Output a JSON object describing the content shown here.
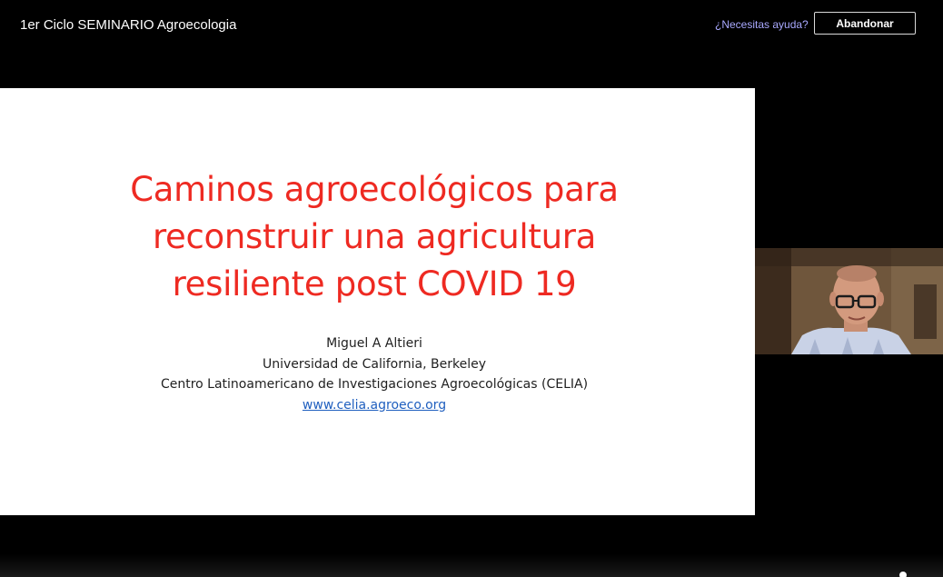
{
  "header": {
    "meeting_title": "1er Ciclo SEMINARIO Agroecologia",
    "help_link": "¿Necesitas ayuda?",
    "leave_button": "Abandonar"
  },
  "slide": {
    "title_lines": [
      "Caminos agroecológicos para",
      "reconstruir una agricultura",
      "resiliente post COVID 19"
    ],
    "author": "Miguel A Altieri",
    "university": "Universidad de California, Berkeley",
    "center": "Centro Latinoamericano de Investigaciones Agroecológicas (CELIA)",
    "website": "www.celia.agroeco.org"
  },
  "colors": {
    "background": "#000000",
    "slide_background": "#ffffff",
    "title_red": "#ee2a22",
    "link_blue": "#1f5fbf",
    "help_link": "#a9a9ff"
  },
  "icons": {
    "participant_video": "speaker-video-feed"
  }
}
